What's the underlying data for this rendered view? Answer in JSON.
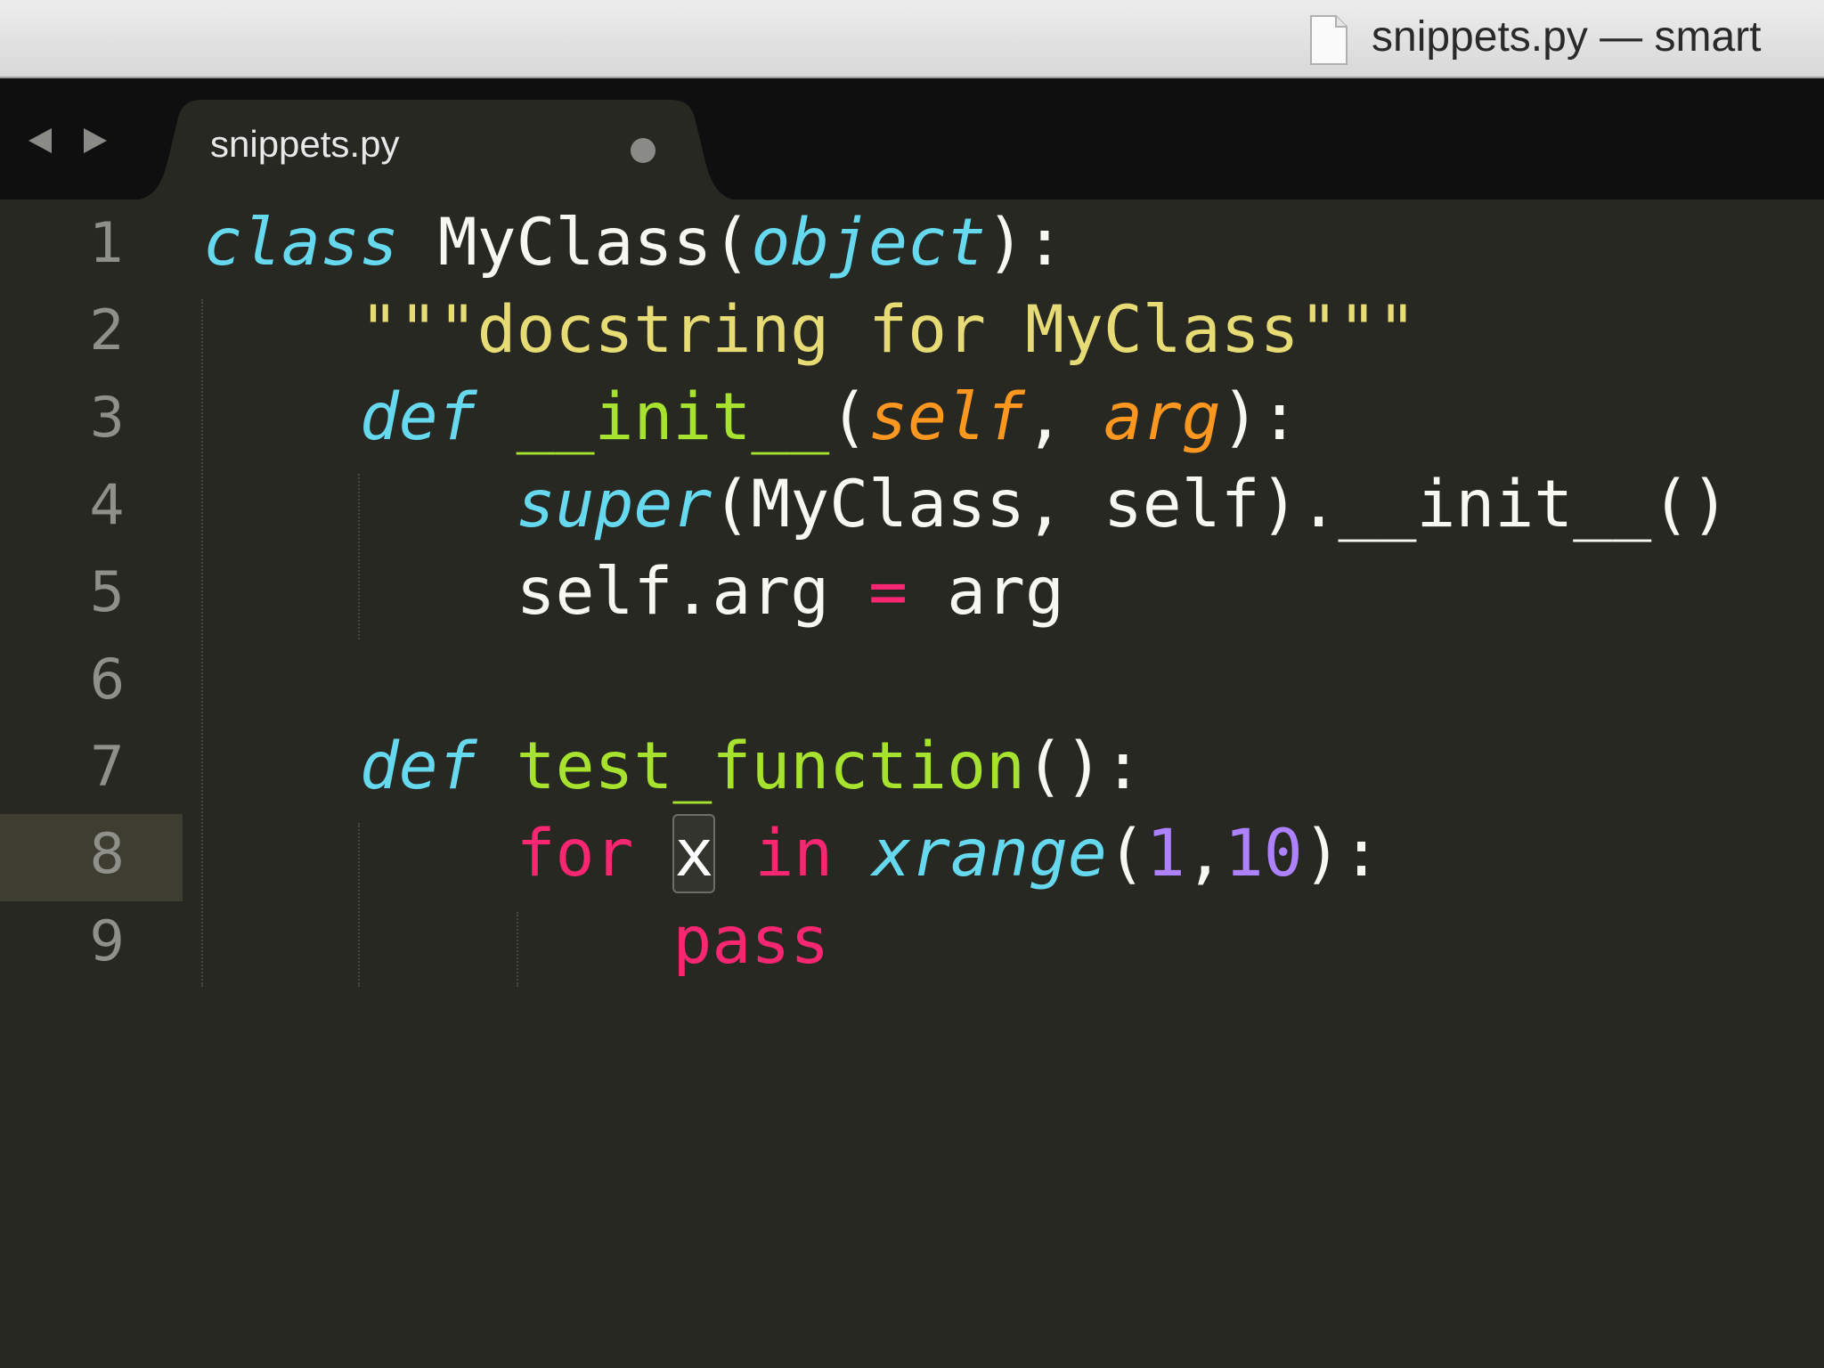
{
  "window": {
    "title": "snippets.py — smart"
  },
  "tabs": [
    {
      "label": "snippets.py",
      "dirty": true
    }
  ],
  "editor": {
    "current_line": 8,
    "lines": [
      {
        "number": "1",
        "tokens": [
          {
            "text": "class",
            "kind": "kw-i"
          },
          {
            "text": " MyClass(",
            "kind": "plain"
          },
          {
            "text": "object",
            "kind": "kw-i"
          },
          {
            "text": "):",
            "kind": "plain"
          }
        ]
      },
      {
        "number": "2",
        "tokens": [
          {
            "text": "    ",
            "kind": "plain"
          },
          {
            "text": "\"\"\"docstring for MyClass\"\"\"",
            "kind": "str"
          }
        ]
      },
      {
        "number": "3",
        "tokens": [
          {
            "text": "    ",
            "kind": "plain"
          },
          {
            "text": "def",
            "kind": "kw-i"
          },
          {
            "text": " ",
            "kind": "plain"
          },
          {
            "text": "__init__",
            "kind": "fn"
          },
          {
            "text": "(",
            "kind": "plain"
          },
          {
            "text": "self",
            "kind": "param"
          },
          {
            "text": ", ",
            "kind": "plain"
          },
          {
            "text": "arg",
            "kind": "param"
          },
          {
            "text": "):",
            "kind": "plain"
          }
        ]
      },
      {
        "number": "4",
        "tokens": [
          {
            "text": "        ",
            "kind": "plain"
          },
          {
            "text": "super",
            "kind": "kw-i"
          },
          {
            "text": "(MyClass, self).__init__()",
            "kind": "plain"
          }
        ]
      },
      {
        "number": "5",
        "tokens": [
          {
            "text": "        ",
            "kind": "plain"
          },
          {
            "text": "self.arg ",
            "kind": "plain"
          },
          {
            "text": "=",
            "kind": "op"
          },
          {
            "text": " arg",
            "kind": "plain"
          }
        ]
      },
      {
        "number": "6",
        "tokens": []
      },
      {
        "number": "7",
        "tokens": [
          {
            "text": "    ",
            "kind": "plain"
          },
          {
            "text": "def",
            "kind": "kw-i"
          },
          {
            "text": " ",
            "kind": "plain"
          },
          {
            "text": "test_function",
            "kind": "fn"
          },
          {
            "text": "():",
            "kind": "plain"
          }
        ]
      },
      {
        "number": "8",
        "tokens": [
          {
            "text": "        ",
            "kind": "plain"
          },
          {
            "text": "for",
            "kind": "kw"
          },
          {
            "text": " ",
            "kind": "plain"
          },
          {
            "text": "x",
            "kind": "sel-x"
          },
          {
            "text": " ",
            "kind": "plain"
          },
          {
            "text": "in",
            "kind": "kw"
          },
          {
            "text": " ",
            "kind": "plain"
          },
          {
            "text": "xrange",
            "kind": "kw-i"
          },
          {
            "text": "(",
            "kind": "plain"
          },
          {
            "text": "1",
            "kind": "num"
          },
          {
            "text": ",",
            "kind": "plain"
          },
          {
            "text": "10",
            "kind": "num"
          },
          {
            "text": "):",
            "kind": "plain"
          }
        ]
      },
      {
        "number": "9",
        "tokens": [
          {
            "text": "            ",
            "kind": "plain"
          },
          {
            "text": "pass",
            "kind": "kw"
          }
        ]
      }
    ]
  },
  "icons": {
    "title_doc": "document-icon",
    "nav_back": "triangle-left-icon",
    "nav_forward": "triangle-right-icon",
    "tab_dirty": "dirty-dot-icon"
  },
  "colors": {
    "background": "#272822",
    "keyword_italic": "#66d9ef",
    "keyword": "#f92672",
    "function": "#a6e22e",
    "string": "#e6db74",
    "parameter": "#fd971f",
    "number": "#ae81ff"
  }
}
